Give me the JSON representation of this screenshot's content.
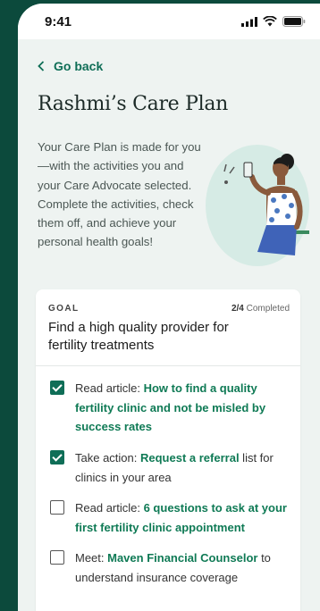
{
  "status": {
    "time": "9:41"
  },
  "nav": {
    "back_label": "Go back"
  },
  "header": {
    "title": "Rashmi’s Care Plan"
  },
  "intro": "Your Care Plan is made for you—with the activities you and your Care Advocate selected. Complete the activities, check them off, and achieve your personal health goals!",
  "goal": {
    "label": "GOAL",
    "progress_count": "2/4",
    "progress_suffix": "Completed",
    "title": "Find a high quality provider for fertility treatments"
  },
  "tasks": [
    {
      "checked": true,
      "prefix": "Read article: ",
      "highlight": "How to find a quality fertility clinic and not be misled by success rates",
      "suffix": ""
    },
    {
      "checked": true,
      "prefix": "Take action: ",
      "highlight": "Request a referral",
      "suffix": " list for clinics in your area"
    },
    {
      "checked": false,
      "prefix": "Read article: ",
      "highlight": "6 questions to ask at your first fertility clinic appointment",
      "suffix": ""
    },
    {
      "checked": false,
      "prefix": "Meet: ",
      "highlight": "Maven Financial Counselor",
      "suffix": " to understand insurance coverage"
    }
  ],
  "colors": {
    "accent": "#0f6e57",
    "background": "#0c4a3c",
    "screen": "#eef3f1"
  }
}
